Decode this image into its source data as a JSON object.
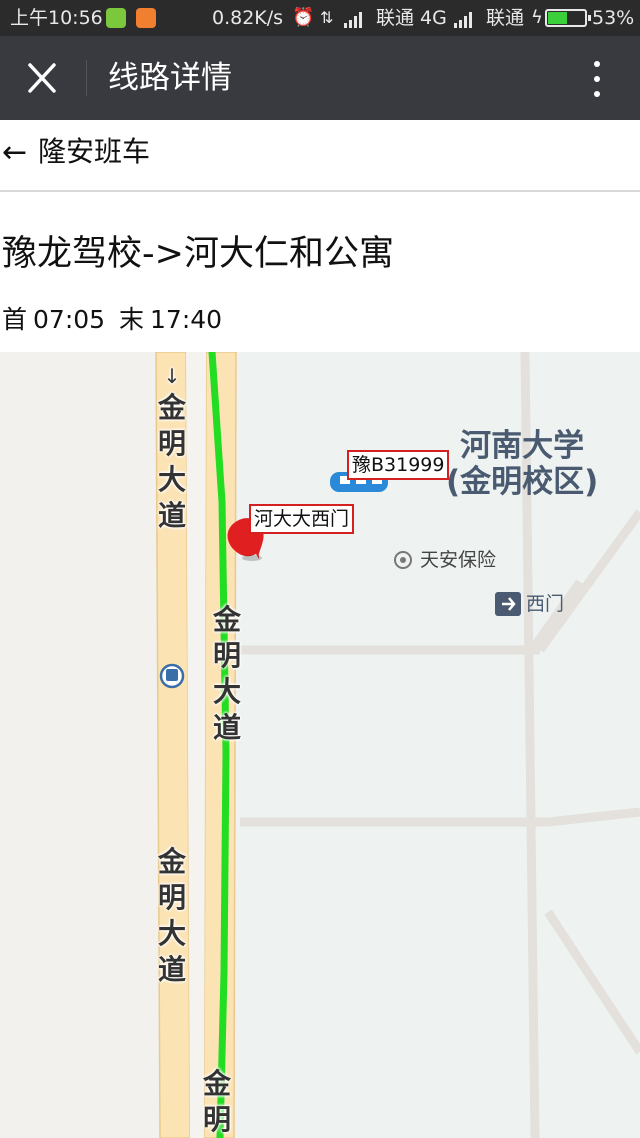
{
  "status_bar": {
    "time": "上午10:56",
    "speed": "0.82K/s",
    "carrier1": "联通 4G",
    "carrier2": "联通",
    "battery_percent": "53%",
    "battery_level": 0.53,
    "icons": [
      "app-green-icon",
      "app-orange-icon",
      "alarm-icon",
      "data-transfer-icon",
      "signal-icon",
      "charging-icon",
      "battery-icon"
    ]
  },
  "title_bar": {
    "title": "线路详情",
    "close_icon": "close-icon",
    "more_icon": "more-vertical-icon"
  },
  "back": {
    "arrow": "←",
    "label": "隆安班车"
  },
  "route": {
    "name": "豫龙驾校->河大仁和公寓",
    "first_label": "首",
    "first_time": "07:05",
    "last_label": "末",
    "last_time": "17:40"
  },
  "map": {
    "road_name_chars": [
      "金",
      "明",
      "大",
      "道"
    ],
    "road_name_partial": [
      "金",
      "明"
    ],
    "direction_arrow": "↓",
    "campus_line1": "河南大学",
    "campus_line2": "(金明校区)",
    "poi_insurance": "天安保险",
    "poi_gate": "西门",
    "bus_plate": "豫B31999",
    "stop_name": "河大大西门",
    "route_color": "#22dd22",
    "pin_color": "#e02020",
    "road_color": "#fbe3b4",
    "bus_color": "#2a8ad8"
  }
}
